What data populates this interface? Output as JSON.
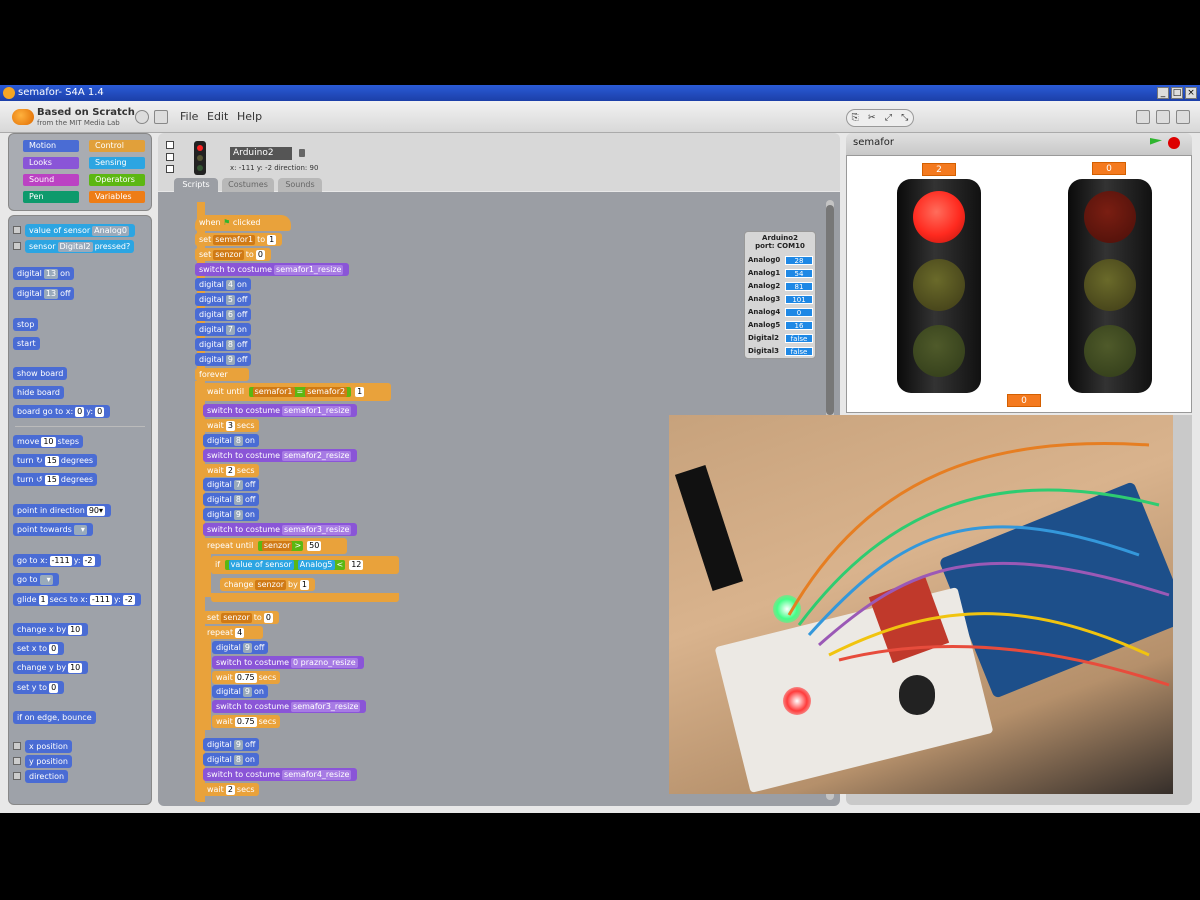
{
  "window": {
    "title": "semafor- S4A 1.4"
  },
  "menubar": {
    "logo_line1": "Based on Scratch",
    "logo_line2": "from the MIT Media Lab",
    "menus": [
      "File",
      "Edit",
      "Help"
    ]
  },
  "categories": {
    "motion": "Motion",
    "control": "Control",
    "looks": "Looks",
    "sensing": "Sensing",
    "sound": "Sound",
    "operators": "Operators",
    "pen": "Pen",
    "variables": "Variables"
  },
  "palette": {
    "value_of_sensor": "value of sensor",
    "analog0": "Analog0",
    "sensor": "sensor",
    "digital2": "Digital2",
    "pressed": "pressed?",
    "digital": "digital",
    "pin13": "13",
    "on": "on",
    "off": "off",
    "stop": "stop",
    "start": "start",
    "show_board": "show board",
    "hide_board": "hide board",
    "board_go_to": "board go to x:",
    "zero": "0",
    "y": "y:",
    "move": "move",
    "ten": "10",
    "steps": "steps",
    "turn": "turn",
    "fifteen": "15",
    "degrees": "degrees",
    "point_in_direction": "point in direction",
    "ninety": "90▾",
    "point_towards": "point towards",
    "go_to_x": "go to x:",
    "neg111": "-111",
    "neg2": "-2",
    "go_to": "go to",
    "glide": "glide",
    "one": "1",
    "secs_to_x": "secs to x:",
    "change_x_by": "change x by",
    "set_x_to": "set x to",
    "change_y_by": "change y by",
    "set_y_to": "set y to",
    "if_on_edge": "if on edge, bounce",
    "x_position": "x position",
    "y_position": "y position",
    "direction": "direction"
  },
  "sprite": {
    "name": "Arduino2",
    "coords": "x: -111  y: -2     direction: 90",
    "tabs": [
      "Scripts",
      "Costumes",
      "Sounds"
    ]
  },
  "script": {
    "when": "when",
    "clicked": "clicked",
    "set": "set",
    "to": "to",
    "semafor1": "semafor1",
    "semafor2": "semafor2",
    "senzor": "senzor",
    "one": "1",
    "zero": "0",
    "switch_to_costume": "switch to costume",
    "semafor1_resize": "semafor1_resize",
    "semafor2_resize": "semafor2_resize",
    "semafor3_resize": "semafor3_resize",
    "semafor4_resize": "semafor4_resize",
    "prazno_resize": "0 prazno_resize",
    "digital": "digital",
    "on": "on",
    "off": "off",
    "p4": "4",
    "p5": "5",
    "p6": "6",
    "p7": "7",
    "p8": "8",
    "p9": "9",
    "forever": "forever",
    "wait_until": "wait until",
    "eq": "=",
    "wait": "wait",
    "secs": "secs",
    "three": "3",
    "two": "2",
    "half": "0.75",
    "repeat_until": "repeat until",
    "gt": ">",
    "fifty": "50",
    "if": "if",
    "value_of_sensor": "value of sensor",
    "analog5": "Analog5",
    "lt": "<",
    "twelve": "12",
    "change": "change",
    "by": "by",
    "repeat": "repeat",
    "four": "4"
  },
  "board": {
    "title": "Arduino2",
    "port": "port: COM10",
    "rows": [
      {
        "label": "Analog0",
        "value": "28"
      },
      {
        "label": "Analog1",
        "value": "54"
      },
      {
        "label": "Analog2",
        "value": "81"
      },
      {
        "label": "Analog3",
        "value": "101"
      },
      {
        "label": "Analog4",
        "value": "0"
      },
      {
        "label": "Analog5",
        "value": "16"
      },
      {
        "label": "Digital2",
        "value": "false"
      },
      {
        "label": "Digital3",
        "value": "false"
      }
    ]
  },
  "stage": {
    "title": "semafor",
    "counter_left": "2",
    "counter_right": "0",
    "counter_bottom": "0"
  },
  "colors": {
    "accent_orange": "#f47a1f",
    "red_lamp": "#ff2a1f",
    "motion_blue": "#4a6cd4"
  }
}
